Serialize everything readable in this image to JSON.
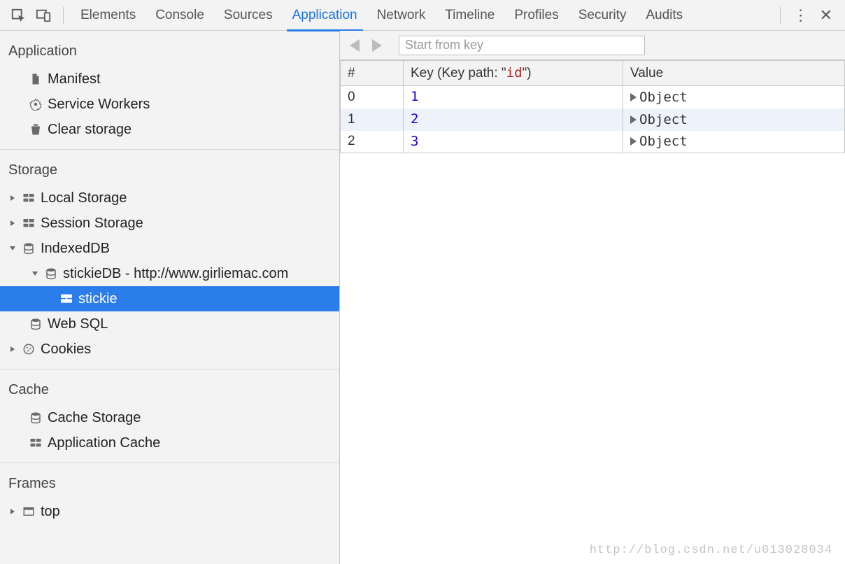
{
  "toolbar": {
    "tabs": [
      {
        "id": "elements",
        "label": "Elements"
      },
      {
        "id": "console",
        "label": "Console"
      },
      {
        "id": "sources",
        "label": "Sources"
      },
      {
        "id": "application",
        "label": "Application"
      },
      {
        "id": "network",
        "label": "Network"
      },
      {
        "id": "timeline",
        "label": "Timeline"
      },
      {
        "id": "profiles",
        "label": "Profiles"
      },
      {
        "id": "security",
        "label": "Security"
      },
      {
        "id": "audits",
        "label": "Audits"
      }
    ],
    "active_tab": "application"
  },
  "sidebar": {
    "sections": {
      "application": {
        "title": "Application",
        "items": [
          {
            "id": "manifest",
            "label": "Manifest"
          },
          {
            "id": "serviceworkers",
            "label": "Service Workers"
          },
          {
            "id": "clearstorage",
            "label": "Clear storage"
          }
        ]
      },
      "storage": {
        "title": "Storage",
        "items": {
          "local": "Local Storage",
          "session": "Session Storage",
          "indexeddb": "IndexedDB",
          "db_entry": "stickieDB - http://www.girliemac.com",
          "store_entry": "stickie",
          "websql": "Web SQL",
          "cookies": "Cookies"
        }
      },
      "cache": {
        "title": "Cache",
        "items": {
          "cachestorage": "Cache Storage",
          "appcache": "Application Cache"
        }
      },
      "frames": {
        "title": "Frames",
        "items": {
          "top": "top"
        }
      }
    }
  },
  "content": {
    "search_placeholder": "Start from key",
    "columns": {
      "index": "#",
      "key_prefix": "Key (Key path: \"",
      "key_path": "id",
      "key_suffix": "\")",
      "value": "Value"
    },
    "rows": [
      {
        "index": "0",
        "key": "1",
        "value": "Object",
        "highlight": false
      },
      {
        "index": "1",
        "key": "2",
        "value": "Object",
        "highlight": true
      },
      {
        "index": "2",
        "key": "3",
        "value": "Object",
        "highlight": false
      }
    ]
  },
  "watermark": "http://blog.csdn.net/u013028034"
}
